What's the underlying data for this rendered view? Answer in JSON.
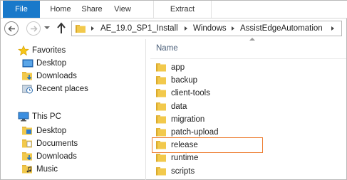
{
  "ribbon": {
    "tabs": [
      {
        "label": "File"
      },
      {
        "label": "Home"
      },
      {
        "label": "Share"
      },
      {
        "label": "View"
      },
      {
        "label": "Extract"
      }
    ]
  },
  "address_bar": {
    "segments": [
      "AE_19.0_SP1_Install",
      "Windows",
      "AssistEdgeAutomation"
    ]
  },
  "navigation_pane": {
    "favorites": {
      "label": "Favorites",
      "items": [
        {
          "label": "Desktop",
          "icon": "desktop-icon"
        },
        {
          "label": "Downloads",
          "icon": "downloads-icon"
        },
        {
          "label": "Recent places",
          "icon": "recent-places-icon"
        }
      ]
    },
    "this_pc": {
      "label": "This PC",
      "items": [
        {
          "label": "Desktop",
          "icon": "desktop-folder-icon"
        },
        {
          "label": "Documents",
          "icon": "documents-icon"
        },
        {
          "label": "Downloads",
          "icon": "downloads-folder-icon"
        },
        {
          "label": "Music",
          "icon": "music-icon"
        }
      ]
    }
  },
  "file_list": {
    "column_header": "Name",
    "items": [
      {
        "name": "app"
      },
      {
        "name": "backup"
      },
      {
        "name": "client-tools"
      },
      {
        "name": "data"
      },
      {
        "name": "migration"
      },
      {
        "name": "patch-upload"
      },
      {
        "name": "release",
        "highlighted": true
      },
      {
        "name": "runtime"
      },
      {
        "name": "scripts"
      }
    ]
  },
  "colors": {
    "file_tab": "#1979ca",
    "highlight_border": "#ed7d31",
    "folder_yellow": "#f2c94c",
    "header_text": "#4c607a"
  }
}
